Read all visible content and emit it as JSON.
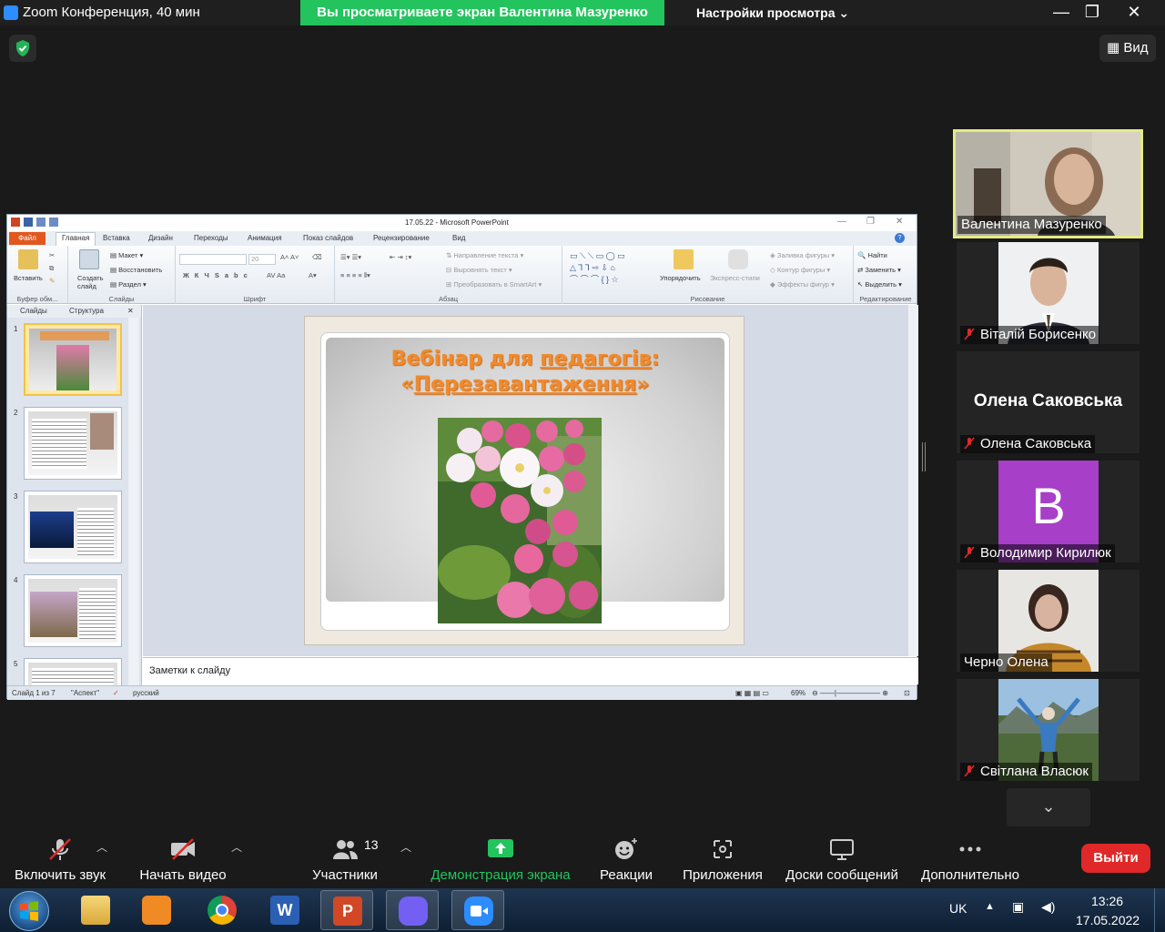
{
  "zoom": {
    "window_title": "Zoom Конференция, 40 мин",
    "share_banner": "Вы просматриваете экран Валентина Мазуренко",
    "view_settings": "Настройки просмотра",
    "view_button": "Вид",
    "minimize": "—",
    "maximize": "❐",
    "close": "✕"
  },
  "ppt": {
    "window_title": "17.05.22 - Microsoft PowerPoint",
    "tabs": [
      "Файл",
      "Главная",
      "Вставка",
      "Дизайн",
      "Переходы",
      "Анимация",
      "Показ слайдов",
      "Рецензирование",
      "Вид"
    ],
    "ribbon": {
      "paste": "Вставить",
      "clipboard_group": "Буфер обм...",
      "create_slide": "Создать слайд",
      "layout": "Макет",
      "restore": "Восстановить",
      "section": "Раздел",
      "slides_group": "Слайды",
      "font_size": "20",
      "font_group": "Шрифт",
      "text_direction": "Направление текста",
      "align_text": "Выровнять текст",
      "smartart": "Преобразовать в SmartArt",
      "paragraph_group": "Абзац",
      "arrange": "Упорядочить",
      "quick_styles": "Экспресс-стили",
      "shape_fill": "Заливка фигуры",
      "shape_outline": "Контур фигуры",
      "shape_effects": "Эффекты фигур",
      "drawing_group": "Рисование",
      "find": "Найти",
      "replace": "Заменить",
      "select": "Выделить",
      "editing_group": "Редактирование"
    },
    "pane_tabs": [
      "Слайды",
      "Структура"
    ],
    "thumb_numbers": [
      "1",
      "2",
      "3",
      "4",
      "5"
    ],
    "slide": {
      "title_line1_plain": "Вебінар для ",
      "title_line1_link": "педагогів",
      "title_line1_end": ":",
      "title_line2_open": "«",
      "title_line2_link": "Перезавантаження",
      "title_line2_close": "»"
    },
    "notes_placeholder": "Заметки к слайду",
    "status": {
      "slide_of": "Слайд 1 из 7",
      "theme": "\"Аспект\"",
      "language": "русский",
      "zoom": "69%"
    }
  },
  "participants": [
    {
      "name": "Валентина Мазуренко",
      "muted": false,
      "video": true,
      "active": true
    },
    {
      "name": "Віталій Борисенко",
      "muted": true,
      "video": true,
      "active": false
    },
    {
      "name": "Олена Саковська",
      "muted": true,
      "video": false,
      "display_name": "Олена Саковська",
      "active": false
    },
    {
      "name": "Володимир Кирилюк",
      "muted": true,
      "video": false,
      "avatar_letter": "B",
      "avatar_color": "#a73fc9",
      "active": false
    },
    {
      "name": "Черно Олена",
      "muted": false,
      "video": true,
      "active": false
    },
    {
      "name": "Світлана Власюк",
      "muted": true,
      "video": true,
      "active": false
    }
  ],
  "toolbar": {
    "unmute": "Включить звук",
    "start_video": "Начать видео",
    "participants": "Участники",
    "participants_count": "13",
    "share_screen": "Демонстрация экрана",
    "reactions": "Реакции",
    "apps": "Приложения",
    "whiteboards": "Доски сообщений",
    "more": "Дополнительно",
    "leave": "Выйти"
  },
  "taskbar": {
    "language": "UK",
    "time": "13:26",
    "date": "17.05.2022"
  },
  "colors": {
    "share_green": "#23c45e",
    "leave_red": "#e02828",
    "active_speaker": "#e6ea86",
    "slide_title": "#f08a2c"
  }
}
